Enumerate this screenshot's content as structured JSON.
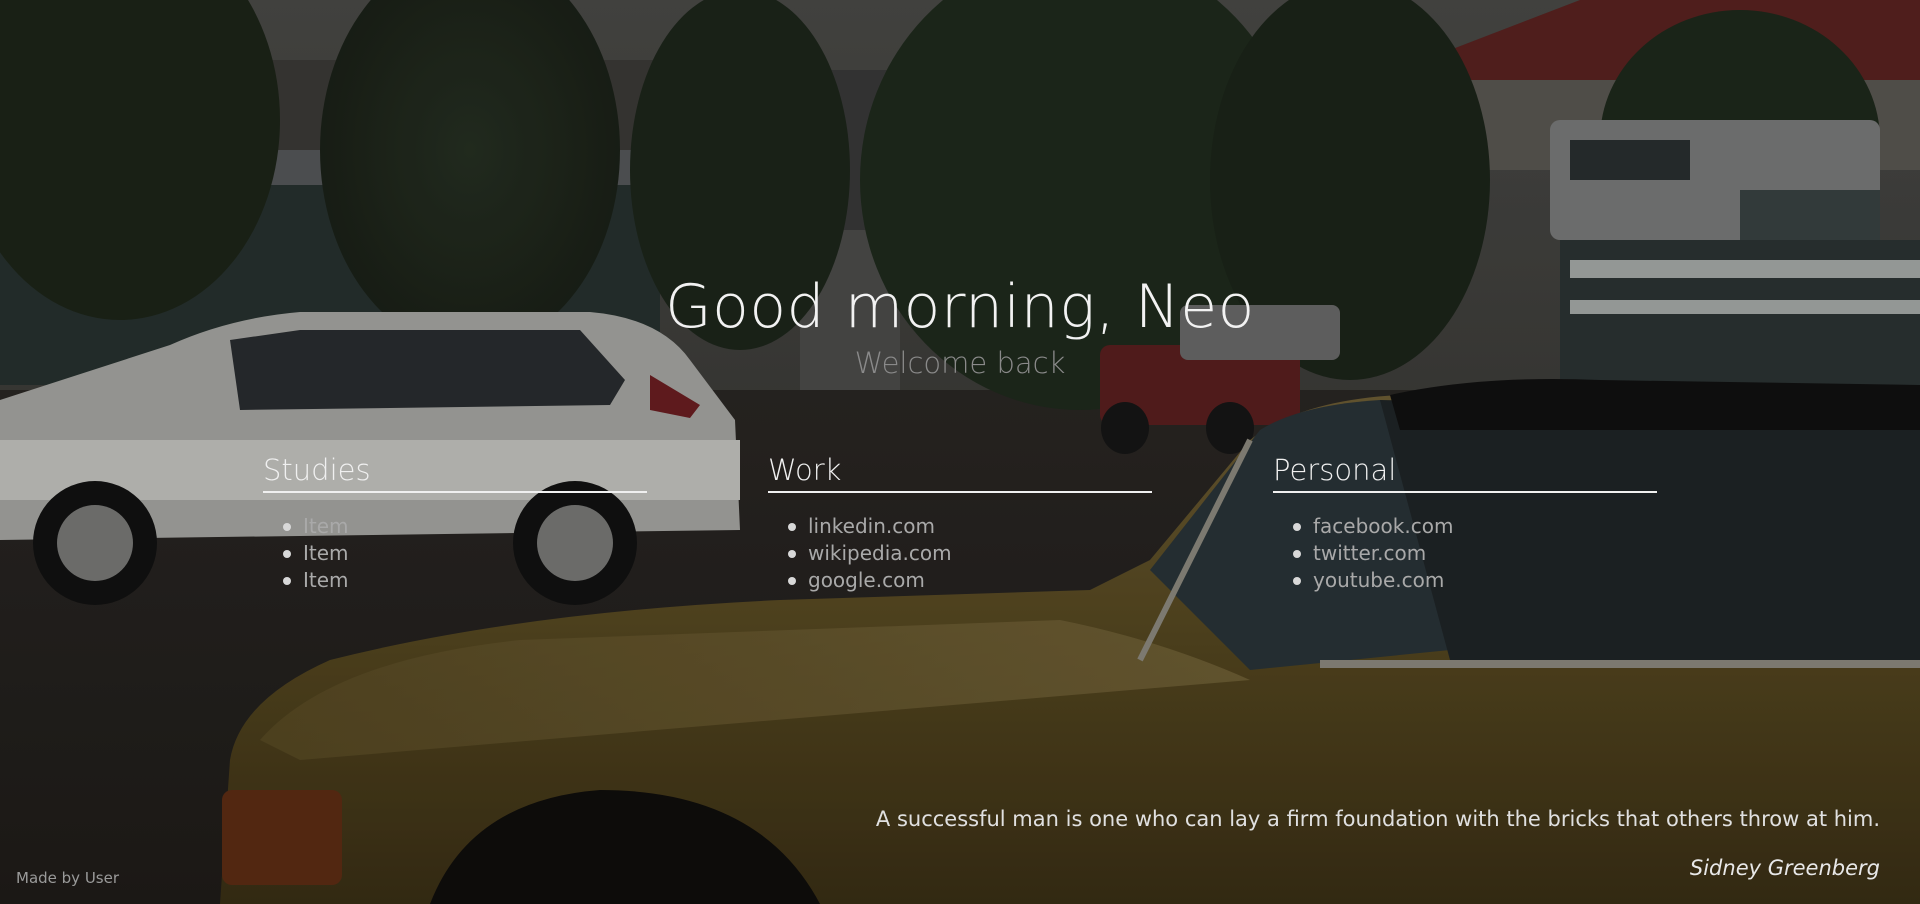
{
  "greeting": "Good morning, Neo",
  "subtitle": "Welcome back",
  "columns": [
    {
      "title": "Studies",
      "items": [
        "Item",
        "Item",
        "Item"
      ]
    },
    {
      "title": "Work",
      "items": [
        "linkedin.com",
        "wikipedia.com",
        "google.com"
      ]
    },
    {
      "title": "Personal",
      "items": [
        "facebook.com",
        "twitter.com",
        "youtube.com"
      ]
    }
  ],
  "quote": {
    "text": "A successful man is one who can lay a firm foundation with the bricks that others throw at him.",
    "author": "Sidney Greenberg"
  },
  "footer": {
    "text": "Made by User"
  },
  "colors": {
    "heading": "#f2f2f2",
    "subtitle": "#8a8a8a",
    "link": "#a9a9a9",
    "underline": "#f0f0f0"
  }
}
